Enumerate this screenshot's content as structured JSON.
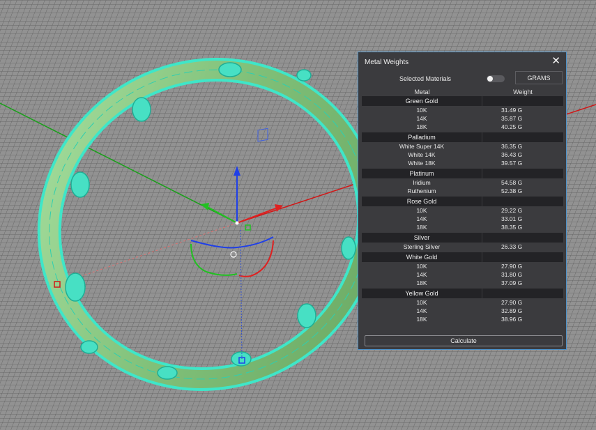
{
  "panel": {
    "title": "Metal Weights",
    "close_glyph": "✕",
    "selected_materials_label": "Selected Materials",
    "unit_button": "GRAMS",
    "col_metal": "Metal",
    "col_weight": "Weight",
    "calculate_label": "Calculate",
    "groups": [
      {
        "name": "Green Gold",
        "rows": [
          {
            "label": "10K",
            "value": "31.49 G"
          },
          {
            "label": "14K",
            "value": "35.87 G"
          },
          {
            "label": "18K",
            "value": "40.25 G"
          }
        ]
      },
      {
        "name": "Palladium",
        "rows": [
          {
            "label": "White Super 14K",
            "value": "36.35 G"
          },
          {
            "label": "White 14K",
            "value": "36.43 G"
          },
          {
            "label": "White 18K",
            "value": "39.57 G"
          }
        ]
      },
      {
        "name": "Platinum",
        "rows": [
          {
            "label": "Iridium",
            "value": "54.58 G"
          },
          {
            "label": "Ruthenium",
            "value": "52.38 G"
          }
        ]
      },
      {
        "name": "Rose Gold",
        "rows": [
          {
            "label": "10K",
            "value": "29.22 G"
          },
          {
            "label": "14K",
            "value": "33.01 G"
          },
          {
            "label": "18K",
            "value": "38.35 G"
          }
        ]
      },
      {
        "name": "Silver",
        "rows": [
          {
            "label": "Sterling Silver",
            "value": "26.33 G"
          }
        ]
      },
      {
        "name": "White Gold",
        "rows": [
          {
            "label": "10K",
            "value": "27.90 G"
          },
          {
            "label": "14K",
            "value": "31.80 G"
          },
          {
            "label": "18K",
            "value": "37.09 G"
          }
        ]
      },
      {
        "name": "Yellow Gold",
        "rows": [
          {
            "label": "10K",
            "value": "27.90 G"
          },
          {
            "label": "14K",
            "value": "32.89 G"
          },
          {
            "label": "18K",
            "value": "38.96 G"
          }
        ]
      }
    ]
  },
  "colors": {
    "panel_bg": "#3b3b3e",
    "panel_border": "#4a90c8",
    "group_bg": "#232326",
    "ring_fill": "#7ec98a",
    "ring_wire": "#3fe6c8",
    "axis_x": "#e02020",
    "axis_y": "#22c022",
    "axis_z": "#2040e8",
    "grid_bg": "#8f8f8f"
  }
}
